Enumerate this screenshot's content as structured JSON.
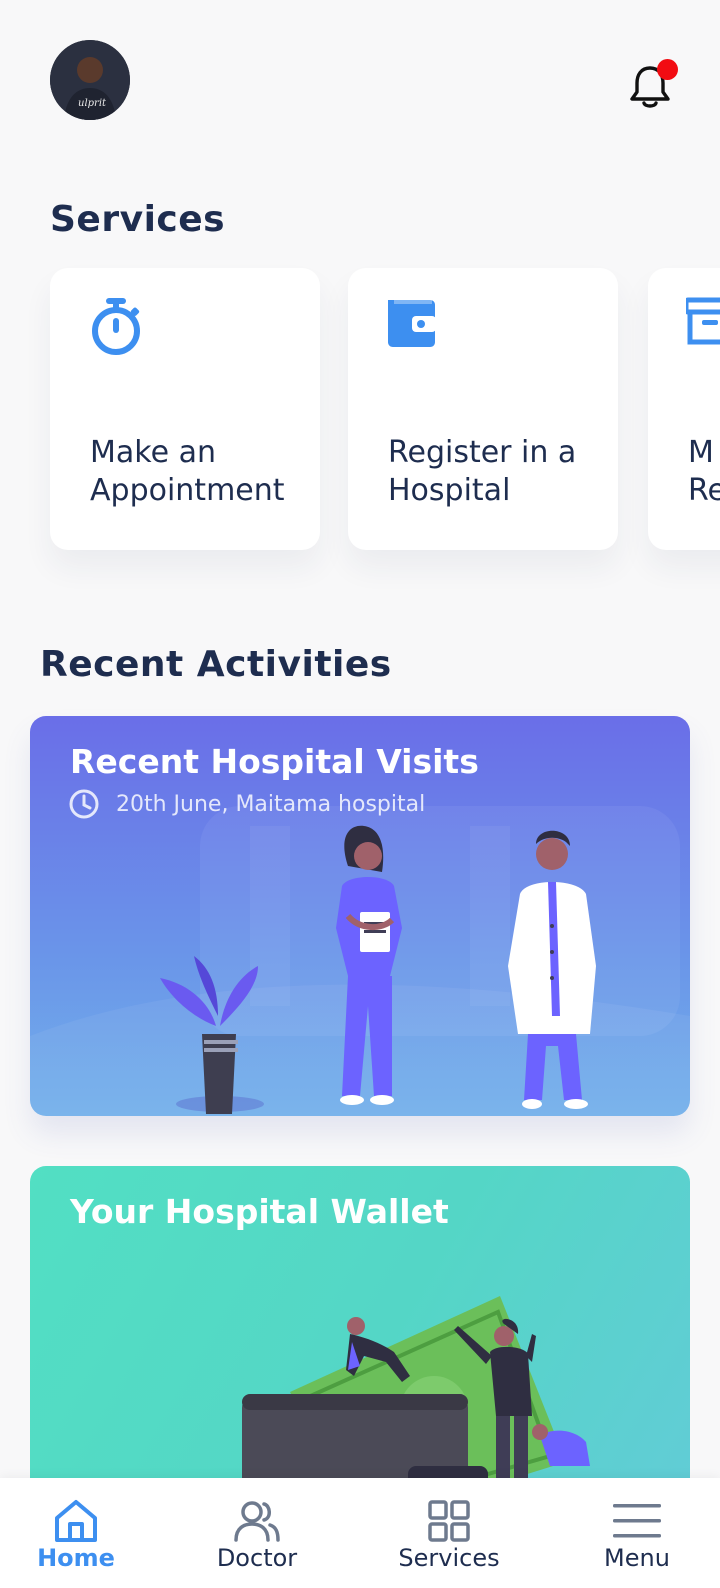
{
  "header": {
    "avatar_icon": "user-avatar",
    "notification_icon": "bell-icon",
    "notification_badge_color": "#f20c12"
  },
  "services": {
    "title": "Services",
    "items": [
      {
        "label": "Make an Appointment",
        "icon": "stopwatch-icon"
      },
      {
        "label": "Register in a Hospital",
        "icon": "wallet-icon"
      },
      {
        "label": "M Re",
        "icon": "archive-icon"
      }
    ],
    "icon_color": "#3d8ff0"
  },
  "activities": {
    "title": "Recent Activities",
    "visits": {
      "title": "Recent Hospital Visits",
      "detail": "20th June, Maitama hospital",
      "icon": "clock-icon"
    },
    "wallet": {
      "title": "Your Hospital Wallet"
    }
  },
  "nav": {
    "items": [
      {
        "label": "Home",
        "icon": "home-icon",
        "active": true
      },
      {
        "label": "Doctor",
        "icon": "users-icon",
        "active": false
      },
      {
        "label": "Services",
        "icon": "grid-icon",
        "active": false
      },
      {
        "label": "Menu",
        "icon": "menu-icon",
        "active": false
      }
    ],
    "active_color": "#3d8ff0"
  }
}
